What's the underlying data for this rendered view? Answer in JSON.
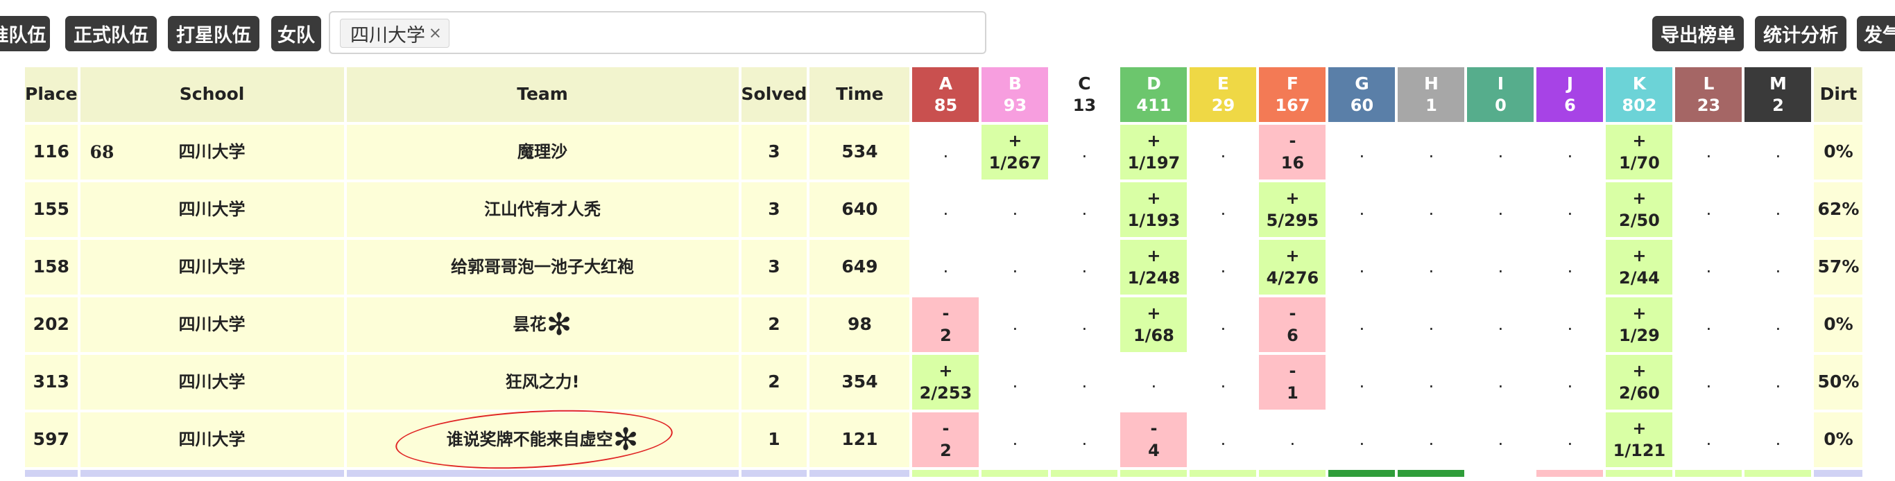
{
  "toolbar": {
    "left_buttons": [
      "准队伍",
      "正式队伍",
      "打星队伍",
      "女队"
    ],
    "filter_tag": "四川大学",
    "filter_tag_close": "×",
    "right_buttons": [
      "导出榜单",
      "统计分析",
      "发气球"
    ]
  },
  "table": {
    "headers": {
      "place": "Place",
      "school": "School",
      "team": "Team",
      "solved": "Solved",
      "time": "Time",
      "dirt": "Dirt"
    },
    "problems": [
      {
        "id": "A",
        "count": "85",
        "color": "#c9504f"
      },
      {
        "id": "B",
        "count": "93",
        "color": "#f79edf"
      },
      {
        "id": "C",
        "count": "13",
        "color": "#ffffff"
      },
      {
        "id": "D",
        "count": "411",
        "color": "#6cc66d"
      },
      {
        "id": "E",
        "count": "29",
        "color": "#efd845"
      },
      {
        "id": "F",
        "count": "167",
        "color": "#f37a55"
      },
      {
        "id": "G",
        "count": "60",
        "color": "#5a7fa8"
      },
      {
        "id": "H",
        "count": "1",
        "color": "#a7a7a7"
      },
      {
        "id": "I",
        "count": "0",
        "color": "#56ad8c"
      },
      {
        "id": "J",
        "count": "6",
        "color": "#a743e6"
      },
      {
        "id": "K",
        "count": "802",
        "color": "#6cd3d7"
      },
      {
        "id": "L",
        "count": "23",
        "color": "#a56665"
      },
      {
        "id": "M",
        "count": "2",
        "color": "#3a3a3a"
      }
    ],
    "rows": [
      {
        "place": "116",
        "school_num": "68",
        "school": "四川大学",
        "team": "魔理沙",
        "star": false,
        "solved": "3",
        "time": "534",
        "dirt": "0%",
        "cells": [
          ".",
          "+\n1/267",
          ".",
          "+\n1/197",
          ".",
          "-\n16",
          ".",
          ".",
          ".",
          ".",
          "+\n1/70",
          ".",
          "."
        ]
      },
      {
        "place": "155",
        "school_num": "",
        "school": "四川大学",
        "team": "江山代有才人秃",
        "star": false,
        "solved": "3",
        "time": "640",
        "dirt": "62%",
        "cells": [
          ".",
          ".",
          ".",
          "+\n1/193",
          ".",
          "+\n5/295",
          ".",
          ".",
          ".",
          ".",
          "+\n2/50",
          ".",
          "."
        ]
      },
      {
        "place": "158",
        "school_num": "",
        "school": "四川大学",
        "team": "给郭哥哥泡一池子大红袍",
        "star": false,
        "solved": "3",
        "time": "649",
        "dirt": "57%",
        "cells": [
          ".",
          ".",
          ".",
          "+\n1/248",
          ".",
          "+\n4/276",
          ".",
          ".",
          ".",
          ".",
          "+\n2/44",
          ".",
          "."
        ]
      },
      {
        "place": "202",
        "school_num": "",
        "school": "四川大学",
        "team": "昙花",
        "star": true,
        "solved": "2",
        "time": "98",
        "dirt": "0%",
        "cells": [
          "-\n2",
          ".",
          ".",
          "+\n1/68",
          ".",
          "-\n6",
          ".",
          ".",
          ".",
          ".",
          "+\n1/29",
          ".",
          "."
        ]
      },
      {
        "place": "313",
        "school_num": "",
        "school": "四川大学",
        "team": "狂风之力!",
        "star": false,
        "solved": "2",
        "time": "354",
        "dirt": "50%",
        "cells": [
          "+\n2/253",
          ".",
          ".",
          ".",
          ".",
          "-\n1",
          ".",
          ".",
          ".",
          ".",
          "+\n2/60",
          ".",
          "."
        ]
      },
      {
        "place": "597",
        "school_num": "",
        "school": "四川大学",
        "team": "谁说奖牌不能来自虚空",
        "star": true,
        "solved": "1",
        "time": "121",
        "dirt": "0%",
        "cells": [
          "-\n2",
          ".",
          ".",
          "-\n4",
          ".",
          ".",
          ".",
          ".",
          ".",
          ".",
          "+\n1/121",
          ".",
          "."
        ]
      }
    ],
    "star_glyph": "✻",
    "next_row_preview_colors": [
      "#d0d2f4",
      "#d0d2f4",
      "#d0d2f4",
      "#d0d2f4",
      "#d0d2f4",
      "#d9ffa5",
      "#d9ffa5",
      "#d9ffa5",
      "#d9ffa5",
      "#d9ffa5",
      "#d9ffa5",
      "#2f9d3a",
      "#2f9d3a",
      "#ffffff",
      "#ffc0c6",
      "#d9ffa5",
      "#d9ffa5",
      "#d9ffa5",
      "#d0d2f4"
    ]
  }
}
